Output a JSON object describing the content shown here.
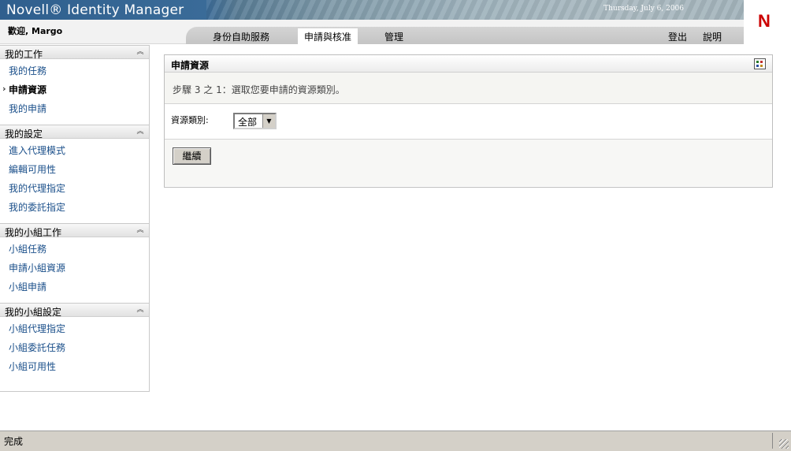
{
  "header": {
    "brand": "Novell® Identity Manager",
    "date": "Thursday, July 6, 2006",
    "logo_letter": "N",
    "welcome": "歡迎, Margo"
  },
  "nav": {
    "tabs": [
      {
        "label": "身份自助服務",
        "active": false
      },
      {
        "label": "申請與核准",
        "active": true
      },
      {
        "label": "管理",
        "active": false
      }
    ],
    "links": [
      "登出",
      "說明"
    ]
  },
  "sidebar": {
    "sections": [
      {
        "title": "我的工作",
        "items": [
          "我的任務",
          "申請資源",
          "我的申請"
        ],
        "active_index": 1
      },
      {
        "title": "我的設定",
        "items": [
          "進入代理模式",
          "編輯可用性",
          "我的代理指定",
          "我的委託指定"
        ]
      },
      {
        "title": "我的小組工作",
        "items": [
          "小組任務",
          "申請小組資源",
          "小組申請"
        ]
      },
      {
        "title": "我的小組設定",
        "items": [
          "小組代理指定",
          "小組委託任務",
          "小組可用性"
        ]
      }
    ]
  },
  "panel": {
    "title": "申請資源",
    "step_text": "步驟 3 之 1：選取您要申請的資源類別。",
    "field_label": "資源類別:",
    "select_value": "全部",
    "continue_label": "繼續"
  },
  "status": {
    "text": "完成"
  },
  "colors": {
    "brand_blue": "#2f5f8e",
    "link": "#1a4f8a",
    "logo_red": "#cc0000"
  }
}
